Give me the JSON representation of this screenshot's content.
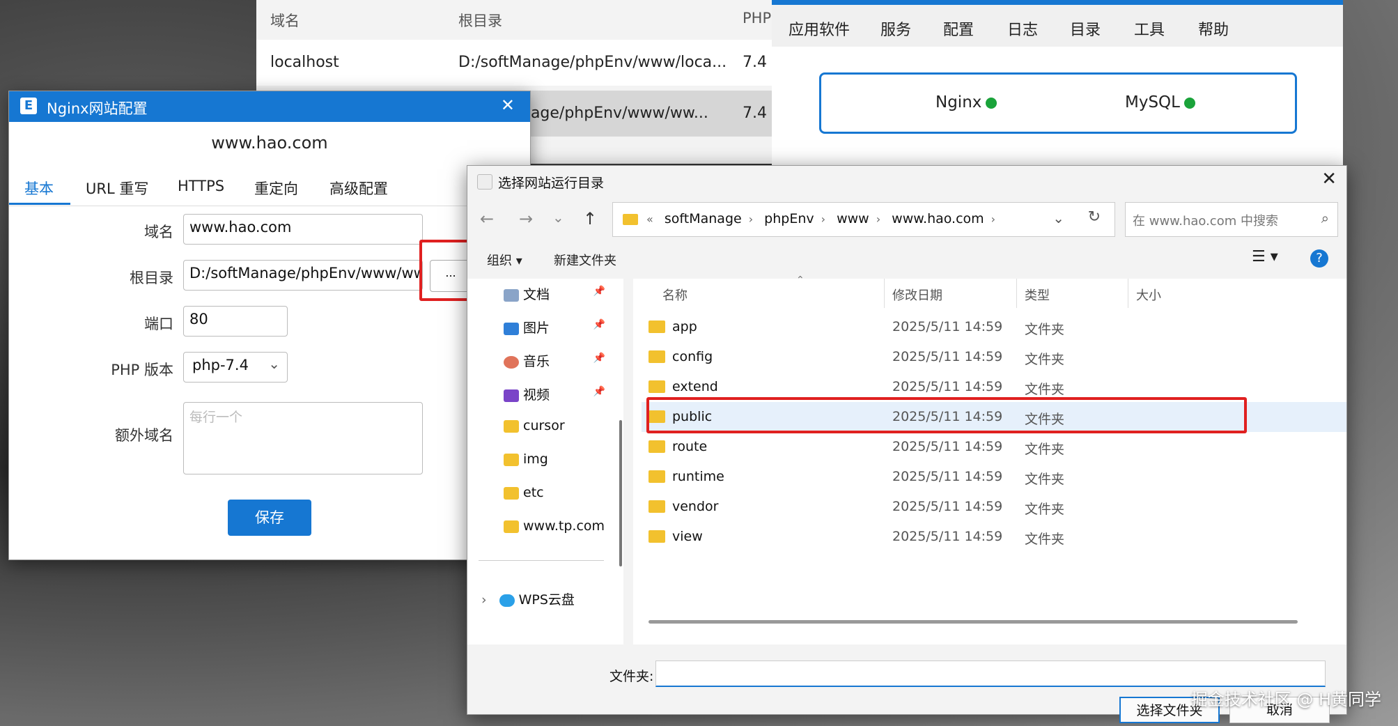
{
  "site_table": {
    "headers": [
      "域名",
      "根目录",
      "PHP"
    ],
    "rows": [
      {
        "domain": "localhost",
        "root": "D:/softManage/phpEnv/www/loca...",
        "php": "7.4"
      },
      {
        "domain": "",
        "root": "nage/phpEnv/www/ww...",
        "php": "7.4"
      }
    ]
  },
  "main_app": {
    "menu": [
      "应用软件",
      "服务",
      "配置",
      "日志",
      "目录",
      "工具",
      "帮助"
    ],
    "services": [
      {
        "name": "Nginx",
        "status_color": "#1aa33a"
      },
      {
        "name": "MySQL",
        "status_color": "#1aa33a"
      }
    ]
  },
  "nginx_dialog": {
    "icon": "E",
    "title": "Nginx网站配置",
    "heading": "www.hao.com",
    "tabs": [
      "基本",
      "URL 重写",
      "HTTPS",
      "重定向",
      "高级配置"
    ],
    "active_tab": "基本",
    "fields": {
      "domain_label": "域名",
      "domain_value": "www.hao.com",
      "root_label": "根目录",
      "root_value": "D:/softManage/phpEnv/www/www.hao.com",
      "browse_label": "...",
      "port_label": "端口",
      "port_value": "80",
      "php_label": "PHP 版本",
      "php_value": "php-7.4",
      "extra_label": "额外域名",
      "extra_placeholder": "每行一个"
    },
    "save_label": "保存"
  },
  "picker": {
    "title": "选择网站运行目录",
    "breadcrumb_prefix": "«",
    "breadcrumbs": [
      "softManage",
      "phpEnv",
      "www",
      "www.hao.com"
    ],
    "search_placeholder": "在 www.hao.com 中搜索",
    "toolbar": {
      "organize": "组织 ▾",
      "new_folder": "新建文件夹",
      "help": "?"
    },
    "nav_items": [
      {
        "label": "文档",
        "icon": "document-icon",
        "pinned": true
      },
      {
        "label": "图片",
        "icon": "pictures-icon",
        "pinned": true
      },
      {
        "label": "音乐",
        "icon": "music-icon",
        "pinned": true
      },
      {
        "label": "视频",
        "icon": "video-icon",
        "pinned": true
      },
      {
        "label": "cursor",
        "icon": "folder-icon",
        "pinned": false
      },
      {
        "label": "img",
        "icon": "folder-icon",
        "pinned": false
      },
      {
        "label": "etc",
        "icon": "folder-icon",
        "pinned": false
      },
      {
        "label": "www.tp.com",
        "icon": "folder-icon",
        "pinned": false
      },
      {
        "label": "WPS云盘",
        "icon": "cloud-icon",
        "pinned": false
      }
    ],
    "columns": [
      "名称",
      "修改日期",
      "类型",
      "大小"
    ],
    "files": [
      {
        "name": "app",
        "date": "2025/5/11 14:59",
        "type": "文件夹"
      },
      {
        "name": "config",
        "date": "2025/5/11 14:59",
        "type": "文件夹"
      },
      {
        "name": "extend",
        "date": "2025/5/11 14:59",
        "type": "文件夹"
      },
      {
        "name": "public",
        "date": "2025/5/11 14:59",
        "type": "文件夹"
      },
      {
        "name": "route",
        "date": "2025/5/11 14:59",
        "type": "文件夹"
      },
      {
        "name": "runtime",
        "date": "2025/5/11 14:59",
        "type": "文件夹"
      },
      {
        "name": "vendor",
        "date": "2025/5/11 14:59",
        "type": "文件夹"
      },
      {
        "name": "view",
        "date": "2025/5/11 14:59",
        "type": "文件夹"
      }
    ],
    "selected_file": "public",
    "folder_label": "文件夹:",
    "folder_value": "",
    "select_button": "选择文件夹",
    "cancel_button": "取消"
  },
  "watermark": "掘金技术社区 @ H黄同学",
  "colors": {
    "accent": "#1677d2",
    "highlight": "#e02020",
    "status_ok": "#1aa33a",
    "folder": "#f2c12e"
  }
}
